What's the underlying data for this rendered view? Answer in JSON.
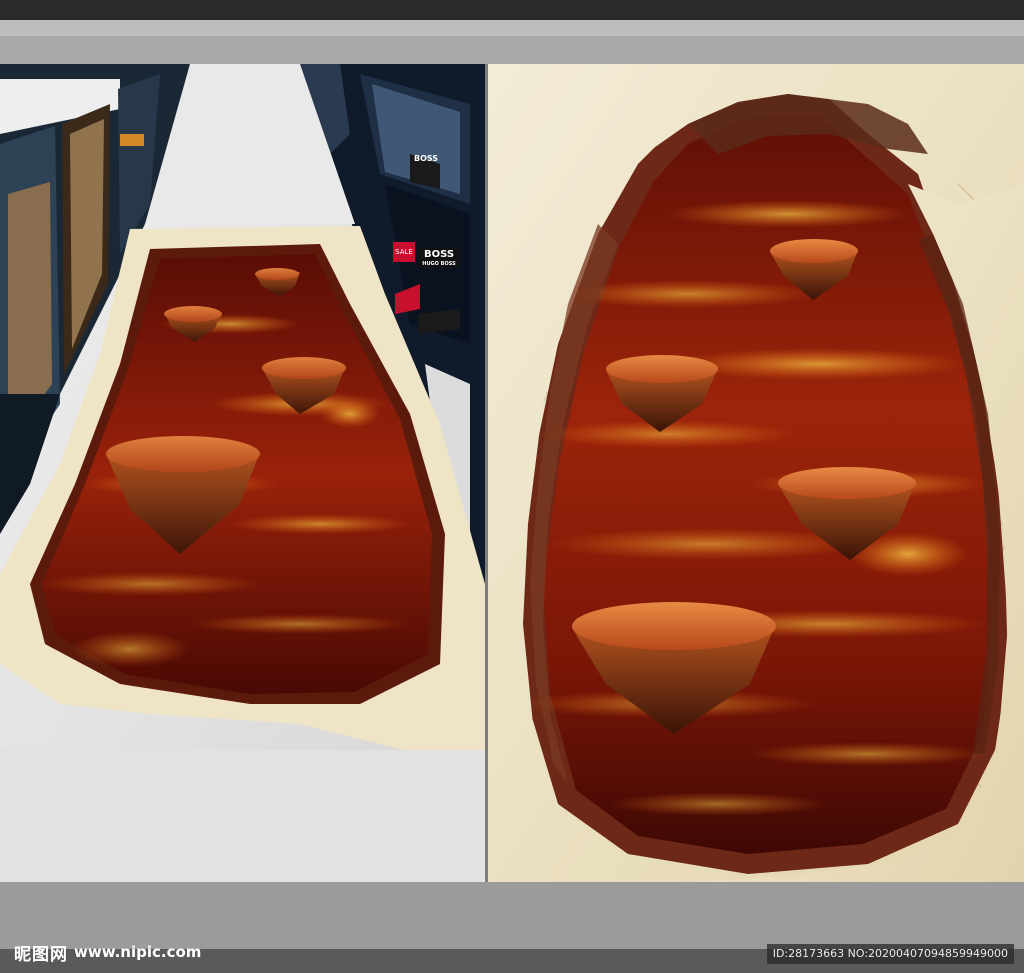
{
  "window": {
    "title": ""
  },
  "storefront": {
    "sign_sale": "SALE",
    "sign_brand": "BOSS",
    "sign_brand_small": "HUGO BOSS",
    "sign_upper": "BOSS"
  },
  "watermark": {
    "logo": "昵图网",
    "url": "www.nipic.com",
    "id_text": "ID:28173663 NO:20200407094859949000"
  },
  "colors": {
    "lava_dark": "#3a0a05",
    "lava_mid": "#8e1c08",
    "lava_bright": "#f7b12a",
    "rock_edge": "#efe4c6",
    "marble": "#e6e6e6",
    "ui_gray": "#9b9b9b"
  }
}
